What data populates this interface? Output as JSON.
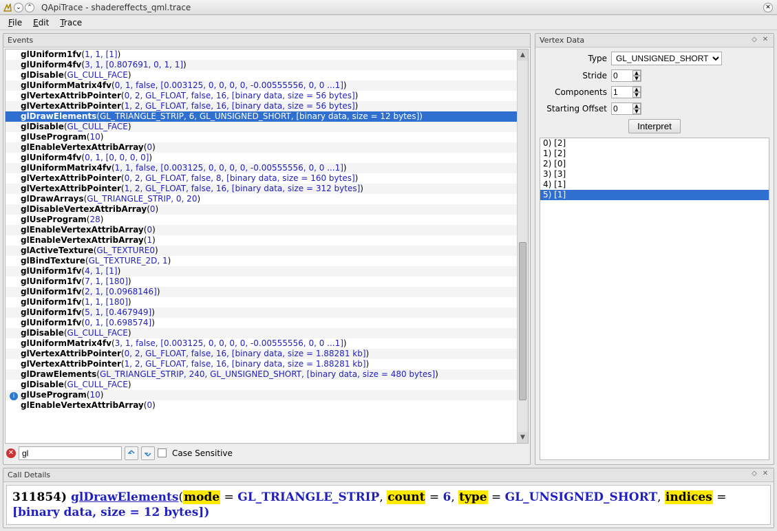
{
  "window": {
    "title": "QApiTrace - shadereffects_qml.trace"
  },
  "menus": [
    "File",
    "Edit",
    "Trace"
  ],
  "events": {
    "title": "Events",
    "search_value": "gl",
    "case_sensitive_label": "Case Sensitive",
    "rows": [
      {
        "fn": "glUniform1fv",
        "args": "1, 1, [1]"
      },
      {
        "fn": "glUniform4fv",
        "args": "3, 1, [0.807691, 0, 1, 1]"
      },
      {
        "fn": "glDisable",
        "args": "GL_CULL_FACE"
      },
      {
        "fn": "glUniformMatrix4fv",
        "args": "0, 1, false, [0.003125, 0, 0, 0, 0, -0.00555556, 0, 0 ...1]"
      },
      {
        "fn": "glVertexAttribPointer",
        "args": "0, 2, GL_FLOAT, false, 16, [binary data, size = 56 bytes]"
      },
      {
        "fn": "glVertexAttribPointer",
        "args": "1, 2, GL_FLOAT, false, 16, [binary data, size = 56 bytes]"
      },
      {
        "fn": "glDrawElements",
        "args": "GL_TRIANGLE_STRIP, 6, GL_UNSIGNED_SHORT, [binary data, size = 12 bytes]",
        "sel": true
      },
      {
        "fn": "glDisable",
        "args": "GL_CULL_FACE"
      },
      {
        "fn": "glUseProgram",
        "args": "10"
      },
      {
        "fn": "glEnableVertexAttribArray",
        "args": "0"
      },
      {
        "fn": "glUniform4fv",
        "args": "0, 1, [0, 0, 0, 0]"
      },
      {
        "fn": "glUniformMatrix4fv",
        "args": "1, 1, false, [0.003125, 0, 0, 0, 0, -0.00555556, 0, 0 ...1]"
      },
      {
        "fn": "glVertexAttribPointer",
        "args": "0, 2, GL_FLOAT, false, 8, [binary data, size = 160 bytes]"
      },
      {
        "fn": "glVertexAttribPointer",
        "args": "1, 2, GL_FLOAT, false, 16, [binary data, size = 312 bytes]"
      },
      {
        "fn": "glDrawArrays",
        "args": "GL_TRIANGLE_STRIP, 0, 20"
      },
      {
        "fn": "glDisableVertexAttribArray",
        "args": "0"
      },
      {
        "fn": "glUseProgram",
        "args": "28"
      },
      {
        "fn": "glEnableVertexAttribArray",
        "args": "0"
      },
      {
        "fn": "glEnableVertexAttribArray",
        "args": "1"
      },
      {
        "fn": "glActiveTexture",
        "args": "GL_TEXTURE0"
      },
      {
        "fn": "glBindTexture",
        "args": "GL_TEXTURE_2D, 1"
      },
      {
        "fn": "glUniform1fv",
        "args": "4, 1, [1]"
      },
      {
        "fn": "glUniform1fv",
        "args": "7, 1, [180]"
      },
      {
        "fn": "glUniform1fv",
        "args": "2, 1, [0.0968146]"
      },
      {
        "fn": "glUniform1fv",
        "args": "1, 1, [180]"
      },
      {
        "fn": "glUniform1fv",
        "args": "5, 1, [0.467949]"
      },
      {
        "fn": "glUniform1fv",
        "args": "0, 1, [0.698574]"
      },
      {
        "fn": "glDisable",
        "args": "GL_CULL_FACE"
      },
      {
        "fn": "glUniformMatrix4fv",
        "args": "3, 1, false, [0.003125, 0, 0, 0, 0, -0.00555556, 0, 0 ...1]"
      },
      {
        "fn": "glVertexAttribPointer",
        "args": "0, 2, GL_FLOAT, false, 16, [binary data, size = 1.88281 kb]"
      },
      {
        "fn": "glVertexAttribPointer",
        "args": "1, 2, GL_FLOAT, false, 16, [binary data, size = 1.88281 kb]"
      },
      {
        "fn": "glDrawElements",
        "args": "GL_TRIANGLE_STRIP, 240, GL_UNSIGNED_SHORT, [binary data, size = 480 bytes]"
      },
      {
        "fn": "glDisable",
        "args": "GL_CULL_FACE"
      },
      {
        "fn": "glUseProgram",
        "args": "10",
        "info": true
      },
      {
        "fn": "glEnableVertexAttribArray",
        "args": "0"
      }
    ]
  },
  "vertex": {
    "title": "Vertex Data",
    "type_label": "Type",
    "type_value": "GL_UNSIGNED_SHORT",
    "stride_label": "Stride",
    "stride_value": "0",
    "components_label": "Components",
    "components_value": "1",
    "offset_label": "Starting Offset",
    "offset_value": "0",
    "interpret_label": "Interpret",
    "rows": [
      {
        "text": "0) [2]"
      },
      {
        "text": "1) [2]"
      },
      {
        "text": "2) [0]"
      },
      {
        "text": "3) [3]"
      },
      {
        "text": "4) [1]"
      },
      {
        "text": "5) [1]",
        "sel": true
      }
    ]
  },
  "call_details": {
    "title": "Call Details",
    "id": "311854",
    "fn": "glDrawElements",
    "params": [
      {
        "name": "mode",
        "value": "GL_TRIANGLE_STRIP"
      },
      {
        "name": "count",
        "value": "6"
      },
      {
        "name": "type",
        "value": "GL_UNSIGNED_SHORT"
      },
      {
        "name": "indices",
        "value": "[binary data, size = 12 bytes]"
      }
    ]
  }
}
